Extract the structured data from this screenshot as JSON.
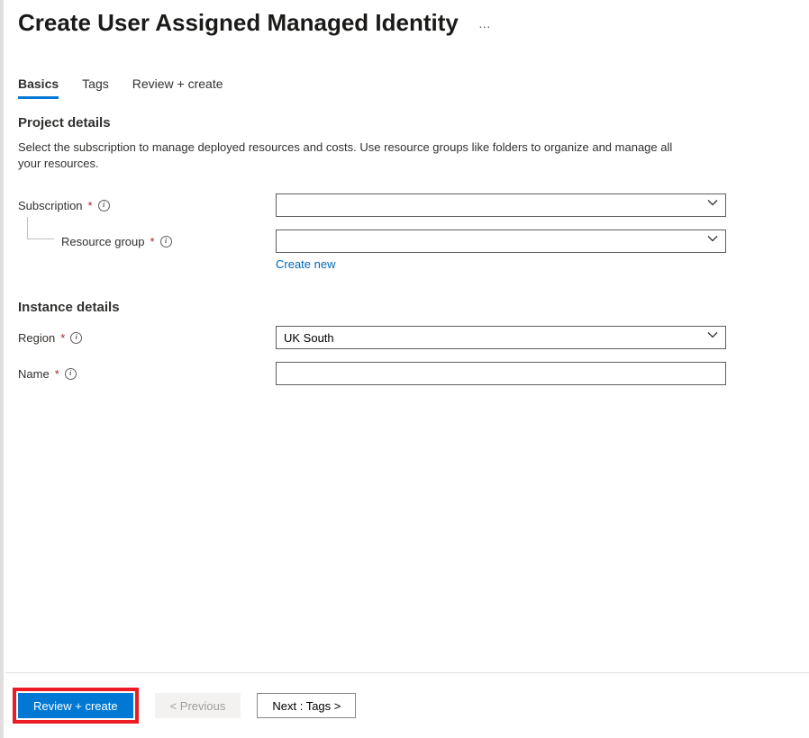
{
  "page": {
    "title": "Create User Assigned Managed Identity",
    "ellipsis_label": "…"
  },
  "tabs": {
    "basics": "Basics",
    "tags": "Tags",
    "review": "Review + create"
  },
  "project": {
    "section_title": "Project details",
    "description": "Select the subscription to manage deployed resources and costs. Use resource groups like folders to organize and manage all your resources.",
    "subscription_label": "Subscription",
    "subscription_value": "",
    "resource_group_label": "Resource group",
    "resource_group_value": "",
    "create_new": "Create new"
  },
  "instance": {
    "section_title": "Instance details",
    "region_label": "Region",
    "region_value": "UK South",
    "name_label": "Name",
    "name_value": ""
  },
  "footer": {
    "review_create": "Review + create",
    "previous": "< Previous",
    "next": "Next : Tags >"
  },
  "colors": {
    "primary": "#0078d4",
    "highlight": "#ed1c24"
  }
}
